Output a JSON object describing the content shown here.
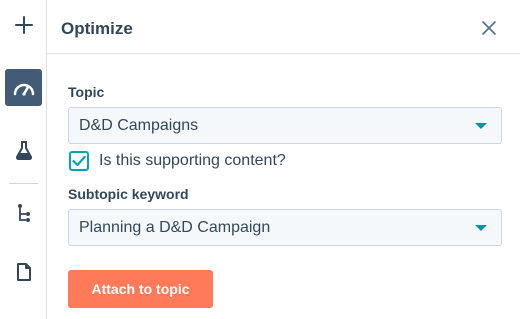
{
  "colors": {
    "rail_active": "#425b76",
    "text": "#33475b",
    "accent_teal": "#00a4bd",
    "caret": "#0091ae",
    "primary_button": "#ff7a59",
    "input_bg": "#f5f8fa",
    "border": "#cbd6e2"
  },
  "rail": {
    "items": [
      {
        "icon": "plus-icon",
        "active": false
      },
      {
        "icon": "speedometer-icon",
        "active": true
      },
      {
        "icon": "flask-icon",
        "active": false
      },
      {
        "icon": "tree-structure-icon",
        "active": false
      },
      {
        "icon": "document-icon",
        "active": false
      }
    ]
  },
  "panel": {
    "title": "Optimize",
    "close_icon": "close-icon"
  },
  "form": {
    "topic_label": "Topic",
    "topic_value": "D&D Campaigns",
    "supporting_checked": true,
    "supporting_label": "Is this supporting content?",
    "subtopic_label": "Subtopic keyword",
    "subtopic_value": "Planning a D&D Campaign",
    "attach_button": "Attach to topic"
  }
}
